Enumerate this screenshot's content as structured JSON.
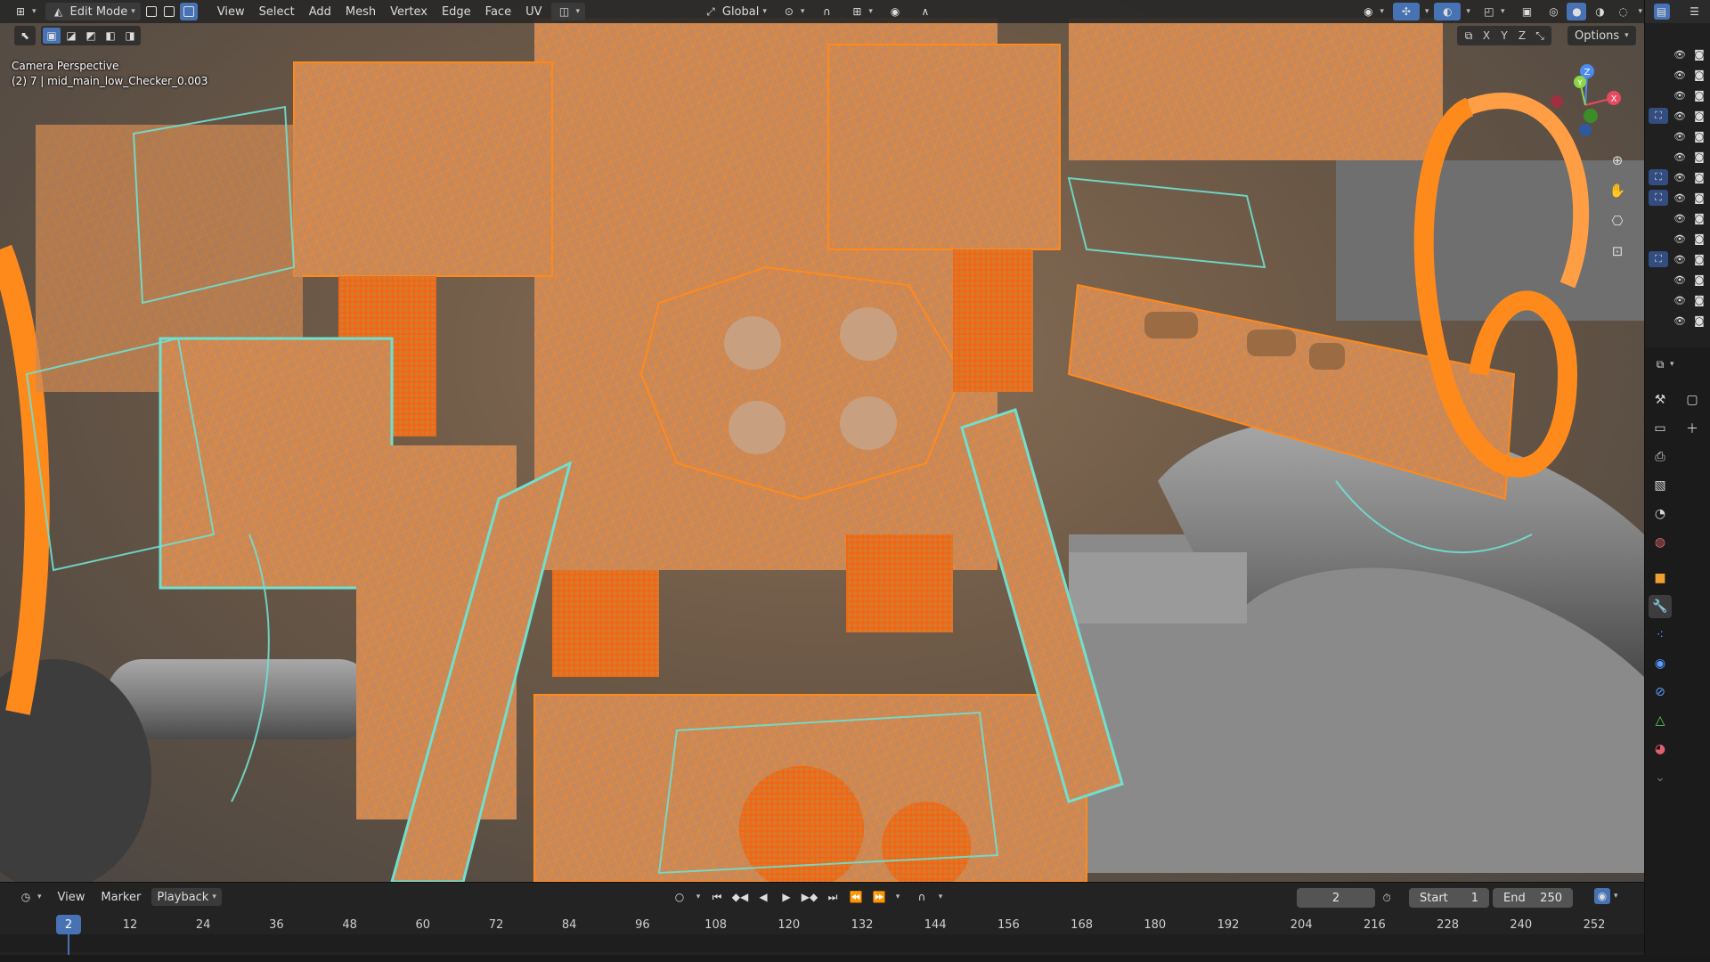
{
  "header": {
    "mode": "Edit Mode",
    "menus": [
      "View",
      "Select",
      "Add",
      "Mesh",
      "Vertex",
      "Edge",
      "Face",
      "UV"
    ],
    "transform_orientation": "Global"
  },
  "viewport": {
    "camera_label": "Camera Perspective",
    "object_label": "(2) 7 | mid_main_low_Checker_0.003",
    "axes": [
      "X",
      "Y",
      "Z"
    ],
    "options_label": "Options",
    "gizmo": {
      "x": "X",
      "y": "Y",
      "z": "Z"
    }
  },
  "outliner": {
    "rows": [
      {
        "selected": false
      },
      {
        "selected": false
      },
      {
        "selected": false
      },
      {
        "selected": true
      },
      {
        "selected": false
      },
      {
        "selected": false
      },
      {
        "selected": true
      },
      {
        "selected": true
      },
      {
        "selected": false
      },
      {
        "selected": false
      },
      {
        "selected": true
      },
      {
        "selected": false
      },
      {
        "selected": false
      },
      {
        "selected": false
      }
    ]
  },
  "timeline": {
    "menus": [
      "View",
      "Marker",
      "Playback"
    ],
    "current_frame": "2",
    "start_label": "Start",
    "start_value": "1",
    "end_label": "End",
    "end_value": "250",
    "ticks": [
      "12",
      "24",
      "36",
      "48",
      "60",
      "72",
      "84",
      "96",
      "108",
      "120",
      "132",
      "144",
      "156",
      "168",
      "180",
      "192",
      "204",
      "216",
      "228",
      "240",
      "252"
    ]
  },
  "colors": {
    "selected_wire": "#ff8a1c",
    "inactive_wire": "#6fe0d0",
    "accent": "#4772b3"
  }
}
